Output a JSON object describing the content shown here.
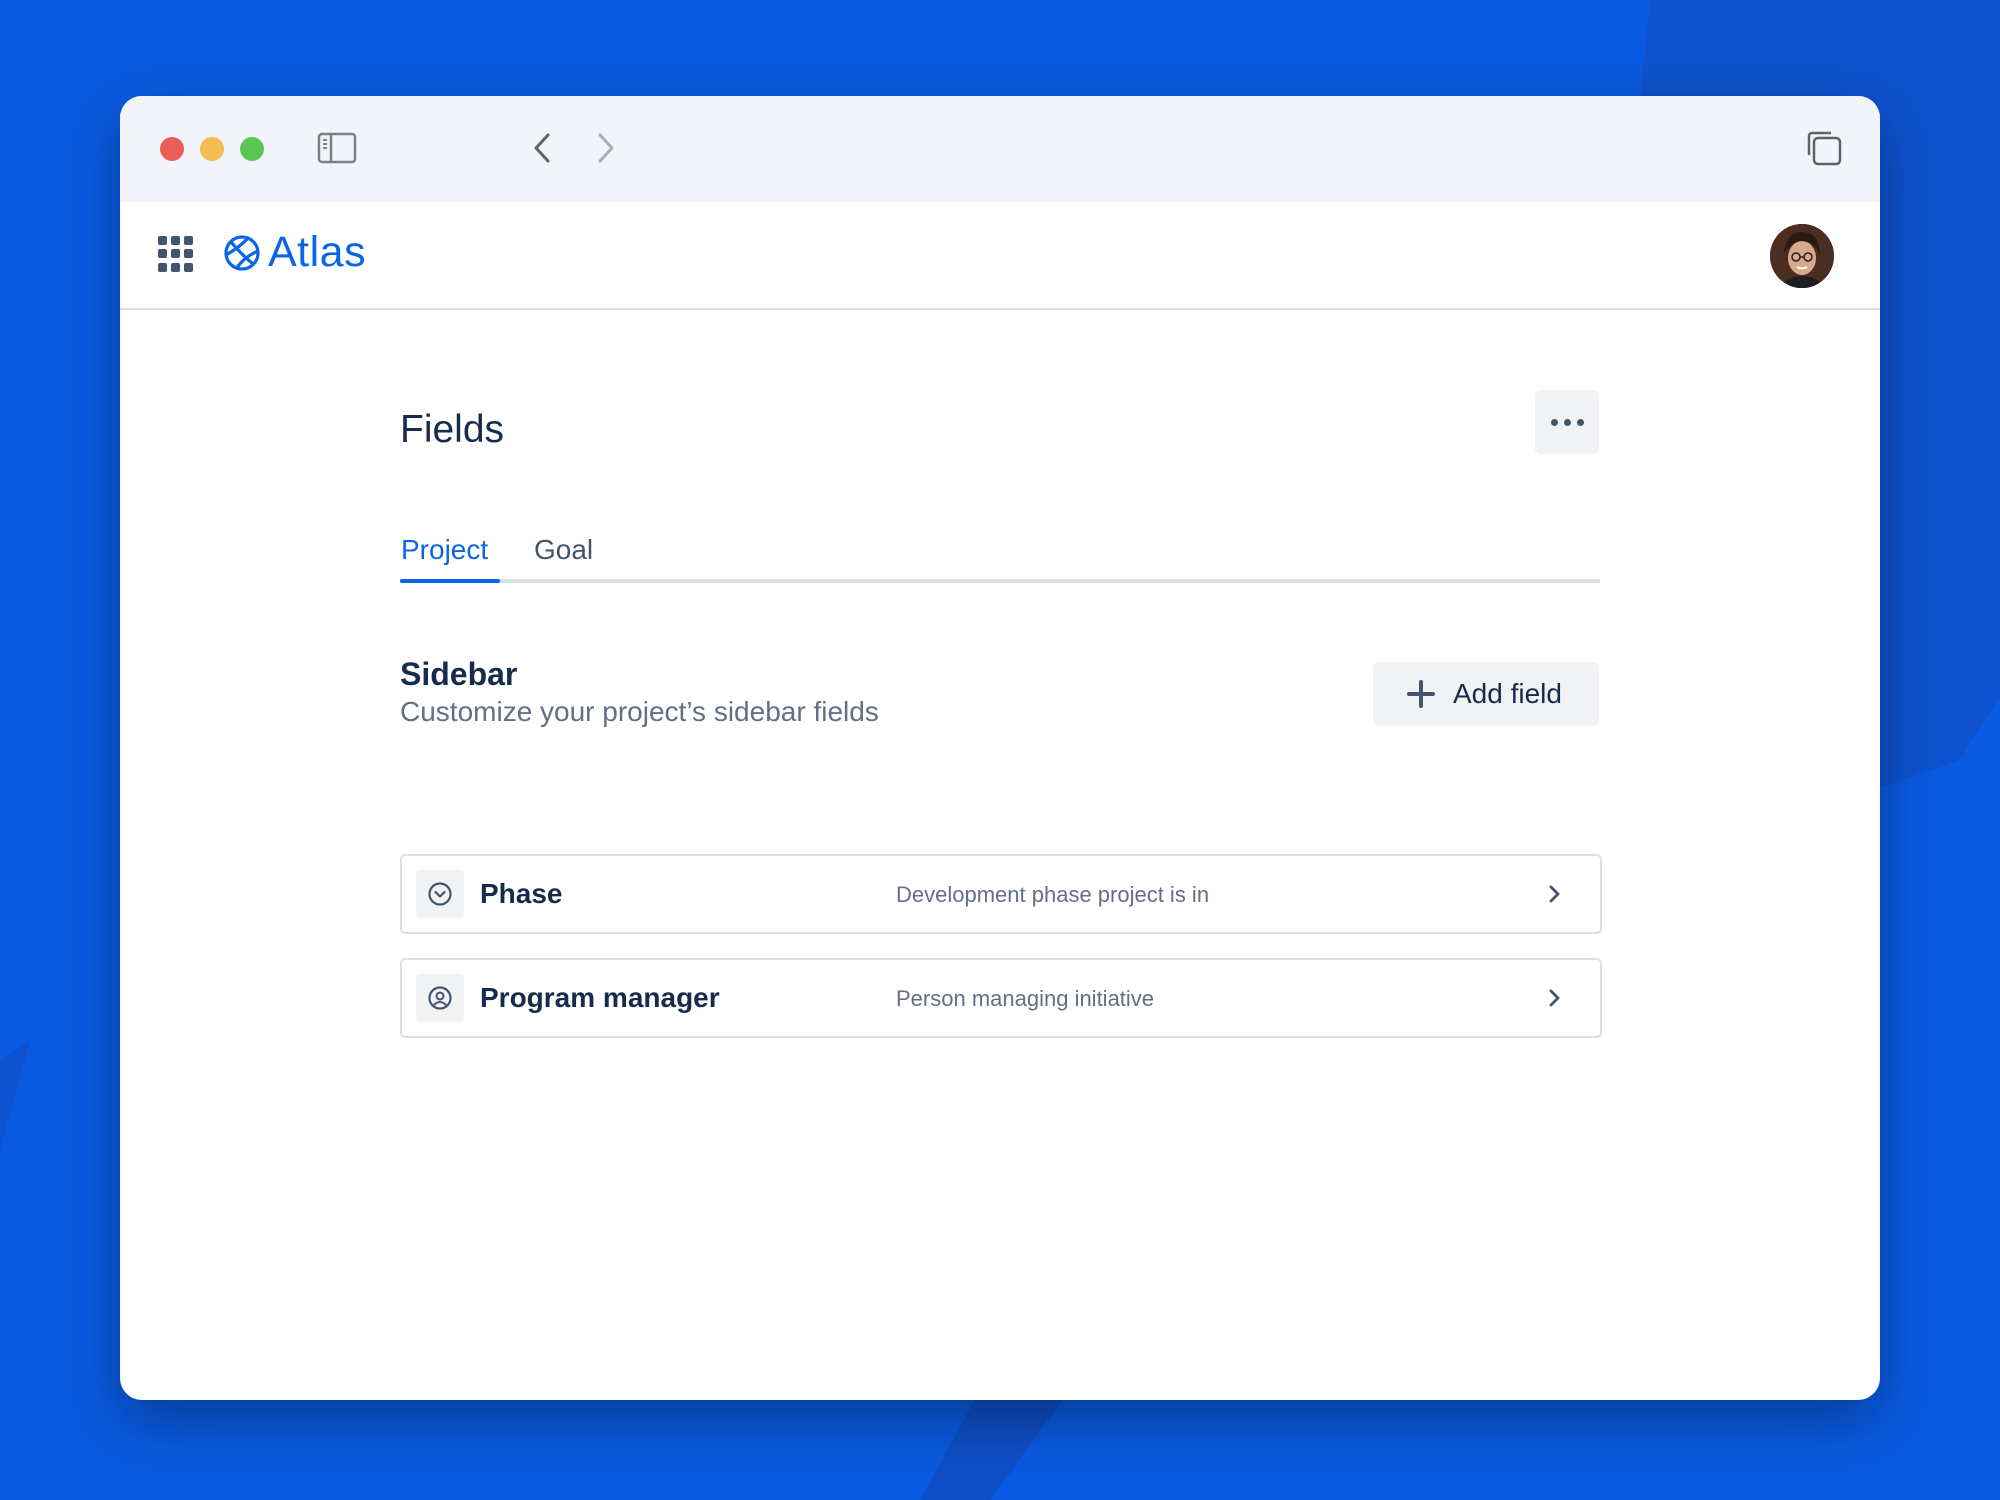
{
  "app": {
    "name": "Atlas",
    "brand_color": "#0c66e4"
  },
  "titlebar": {
    "icons": [
      "sidebar-toggle-icon",
      "back-arrow-icon",
      "forward-arrow-icon",
      "tabs-overview-icon"
    ]
  },
  "page": {
    "title": "Fields",
    "more_icon": "ellipsis-icon"
  },
  "tabs": [
    {
      "label": "Project",
      "active": true
    },
    {
      "label": "Goal",
      "active": false
    }
  ],
  "section": {
    "title": "Sidebar",
    "subtitle": "Customize your project’s sidebar fields",
    "add_button_label": "Add field"
  },
  "fields": [
    {
      "name": "Phase",
      "description": "Development phase project is in",
      "icon": "dropdown-circle-icon"
    },
    {
      "name": "Program manager",
      "description": "Person managing initiative",
      "icon": "person-circle-icon"
    }
  ]
}
